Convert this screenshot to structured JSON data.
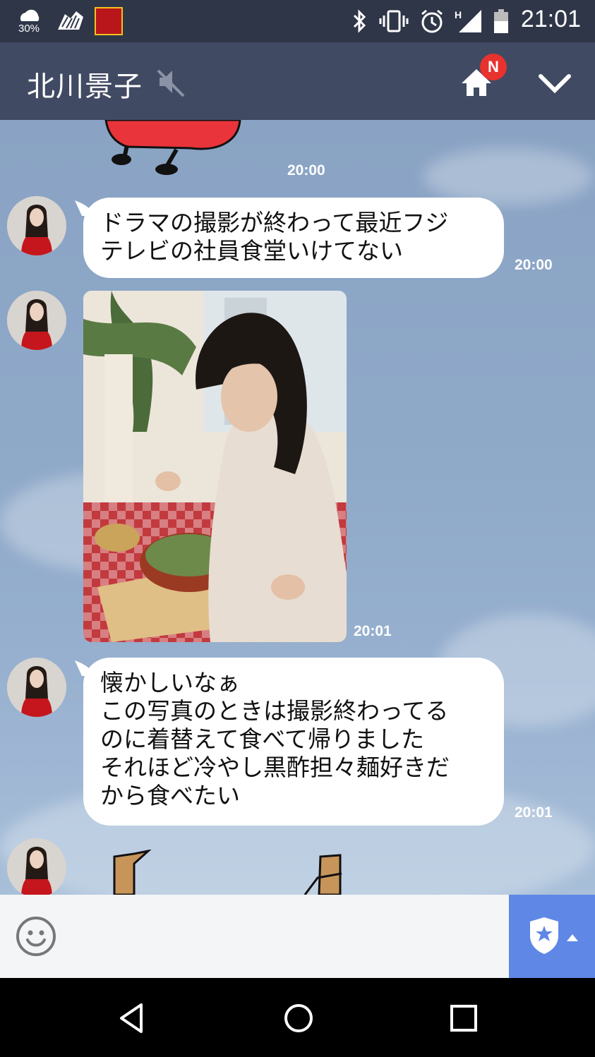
{
  "status_bar": {
    "weather_percent": "30%",
    "time": "21:01"
  },
  "header": {
    "title": "北川景子",
    "badge": "N"
  },
  "messages": [
    {
      "type": "sticker",
      "time": "20:00"
    },
    {
      "type": "text",
      "text": "ドラマの撮影が終わって最近フジ\nテレビの社員食堂いけてない",
      "time": "20:00"
    },
    {
      "type": "photo",
      "time": "20:01"
    },
    {
      "type": "text",
      "text": "懐かしいなぁ\nこの写真のときは撮影終わってる\nのに着替えて食べて帰りました\nそれほど冷やし黒酢担々麺好きだ\nから食べたい",
      "time": "20:01"
    },
    {
      "type": "sticker"
    }
  ],
  "colors": {
    "status_bar": "#2f3648",
    "header": "#414a63",
    "chat_background": "#8aa3c4",
    "badge": "#e8322d",
    "sticker_button": "#5e87e6"
  }
}
